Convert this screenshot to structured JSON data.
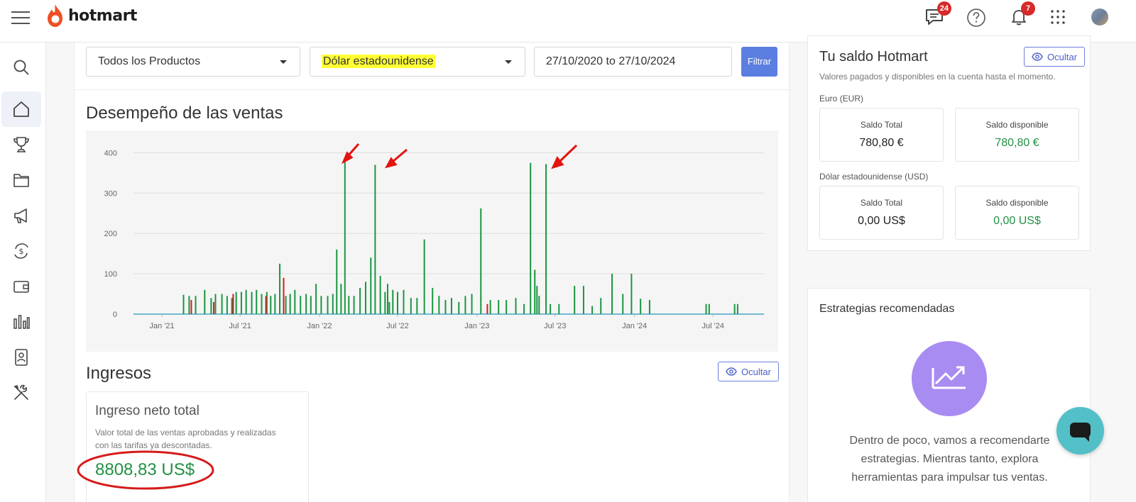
{
  "header": {
    "logo_text": "hotmart",
    "badges": {
      "messages": "24",
      "notifications": "7"
    }
  },
  "sidebar": {
    "items": [
      "search",
      "home",
      "trophy",
      "folder",
      "megaphone",
      "exchange",
      "wallet",
      "analytics",
      "contacts",
      "tools"
    ],
    "active": "home"
  },
  "filters": {
    "product": "Todos los Productos",
    "currency": "Dólar estadounidense",
    "date_range": "27/10/2020 to 27/10/2024",
    "filter_button": "Filtrar"
  },
  "sales": {
    "title": "Desempeño de las ventas"
  },
  "chart_data": {
    "type": "line",
    "title": "",
    "xlabel": "",
    "ylabel": "",
    "ylim": [
      0,
      420
    ],
    "yticks": [
      "0",
      "100",
      "200",
      "300",
      "400"
    ],
    "xticks": [
      "Jan '21",
      "Jul '21",
      "Jan '22",
      "Jul '22",
      "Jan '23",
      "Jul '23",
      "Jan '24",
      "Jul '24"
    ],
    "x_range": [
      "2020-10-27",
      "2024-10-27"
    ],
    "colors": {
      "approved": "#1a9641",
      "refunded": "#d7191c",
      "grid": "#dddddd"
    },
    "series": [
      {
        "x": [
          "2021-02-20",
          "2021-03-05",
          "2021-03-20",
          "2021-04-10",
          "2021-04-25",
          "2021-05-05",
          "2021-05-20",
          "2021-06-01",
          "2021-06-12",
          "2021-06-22",
          "2021-07-04",
          "2021-07-15",
          "2021-07-28",
          "2021-08-08",
          "2021-08-20",
          "2021-09-01",
          "2021-09-10",
          "2021-09-20",
          "2021-10-01",
          "2021-10-15",
          "2021-10-25",
          "2021-11-05",
          "2021-11-18",
          "2021-12-01",
          "2021-12-12",
          "2021-12-24",
          "2022-01-05",
          "2022-01-20",
          "2022-02-01",
          "2022-02-10",
          "2022-02-20",
          "2022-03-01",
          "2022-03-10",
          "2022-03-22",
          "2022-04-05",
          "2022-04-18",
          "2022-04-30",
          "2022-05-10",
          "2022-05-22",
          "2022-06-02",
          "2022-06-08",
          "2022-06-12",
          "2022-06-20",
          "2022-07-01",
          "2022-07-15",
          "2022-08-01",
          "2022-08-15",
          "2022-09-01",
          "2022-09-20",
          "2022-10-05",
          "2022-10-20",
          "2022-11-03",
          "2022-11-20",
          "2022-12-05",
          "2022-12-20",
          "2023-01-10",
          "2023-02-01",
          "2023-02-20",
          "2023-03-10",
          "2023-04-01",
          "2023-04-20",
          "2023-05-05",
          "2023-05-15",
          "2023-05-20",
          "2023-05-25",
          "2023-06-10",
          "2023-06-20",
          "2023-07-10",
          "2023-08-15",
          "2023-09-05",
          "2023-09-25",
          "2023-10-15",
          "2023-11-10",
          "2023-12-05",
          "2023-12-25",
          "2024-01-15",
          "2024-02-05",
          "2024-06-15",
          "2024-06-22",
          "2024-08-20",
          "2024-08-27"
        ],
        "values": [
          48,
          45,
          45,
          60,
          40,
          50,
          50,
          45,
          40,
          55,
          55,
          60,
          55,
          60,
          50,
          55,
          45,
          50,
          125,
          45,
          50,
          60,
          45,
          50,
          45,
          75,
          45,
          45,
          50,
          160,
          75,
          380,
          45,
          45,
          65,
          80,
          140,
          370,
          95,
          55,
          75,
          30,
          60,
          55,
          60,
          40,
          40,
          185,
          65,
          45,
          35,
          40,
          30,
          45,
          50,
          262,
          35,
          35,
          35,
          40,
          25,
          375,
          110,
          70,
          45,
          372,
          25,
          25,
          70,
          70,
          20,
          40,
          100,
          50,
          100,
          38,
          35,
          25,
          25,
          25,
          25
        ],
        "name": ""
      },
      {
        "x": [
          "2021-03-10",
          "2021-05-01",
          "2021-06-15",
          "2021-08-30",
          "2021-10-10",
          "2023-01-25"
        ],
        "values": [
          35,
          30,
          50,
          45,
          90,
          25
        ],
        "name": ""
      }
    ]
  },
  "income": {
    "title": "Ingresos",
    "hide_button": "Ocultar",
    "card_title": "Ingreso neto total",
    "card_desc_line1": "Valor total de las ventas aprobadas y realizadas",
    "card_desc_line2": "con las tarifas ya descontadas.",
    "card_value": "8808,83 US$"
  },
  "balance": {
    "title": "Tu saldo Hotmart",
    "hide_button": "Ocultar",
    "subtitle": "Valores pagados y disponibles en la cuenta hasta el momento.",
    "groups": [
      {
        "label": "Euro (EUR)",
        "total_label": "Saldo Total",
        "total": "780,80 €",
        "available_label": "Saldo disponible",
        "available": "780,80 €"
      },
      {
        "label": "Dólar estadounidense (USD)",
        "total_label": "Saldo Total",
        "total": "0,00 US$",
        "available_label": "Saldo disponible",
        "available": "0,00 US$"
      }
    ]
  },
  "strategies": {
    "title": "Estrategias recomendadas",
    "line1": "Dentro de poco, vamos a recomendarte",
    "line2": "estrategias. Mientras tanto, explora",
    "line3": "herramientas para impulsar tus ventas."
  }
}
